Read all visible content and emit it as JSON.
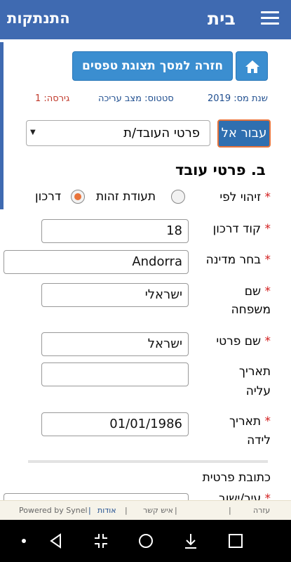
{
  "appbar": {
    "title": "בית",
    "logout_label": "התנתקות"
  },
  "toolbar": {
    "return_label": "חזרה למסך תצוגת טפסים"
  },
  "status": {
    "tax_year": "שנת מס: 2019",
    "status_text": "סטטוס: מצב עריכה",
    "version": "גירסה: 1"
  },
  "goto": {
    "button_label": "עבור אל",
    "selected_value": "פרטי העובד/ת"
  },
  "section": {
    "title": "ב. פרטי עובד"
  },
  "form": {
    "id_by_label": "זיהוי לפי",
    "id_option_teudat": "תעודת זהות",
    "id_option_passport": "דרכון",
    "passport_code_label": "קוד דרכון",
    "passport_code_value": "18",
    "country_label": "בחר מדינה",
    "country_value": "Andorra",
    "last_name_label_1": "שם",
    "last_name_label_2": "משפחה",
    "last_name_value": "ישראלי",
    "first_name_label": "שם פרטי",
    "first_name_value": "ישראל",
    "aliya_label_1": "תאריך",
    "aliya_label_2": "עליה",
    "aliya_value": "",
    "birth_label_1": "תאריך",
    "birth_label_2": "לידה",
    "birth_value": "01/01/1986",
    "address_label": "כתובת פרטית",
    "city_label_partial": "עיר/ישוב"
  },
  "footer": {
    "help": "עזרה",
    "contact": "איש קשר",
    "about": "אודות",
    "powered": "Powered by Synel",
    "sep": "|"
  },
  "icons": {
    "menu": "menu-icon",
    "home": "home-icon",
    "nav_back": "back-icon",
    "nav_home": "circle-icon",
    "nav_recents": "square-icon"
  },
  "colors": {
    "appbar": "#3f6ab1",
    "button": "#3b8ed0",
    "accent": "#e8733a",
    "required": "#d21c1c"
  }
}
